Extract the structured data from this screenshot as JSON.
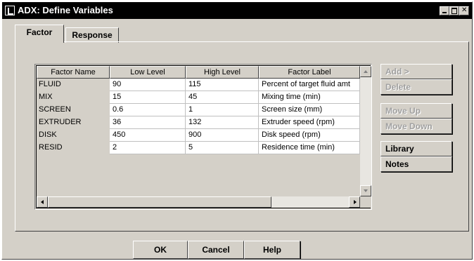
{
  "window": {
    "title": "ADX: Define Variables",
    "icon": "app-icon",
    "controls": [
      "minimize-icon",
      "maximize-icon",
      "close-icon"
    ]
  },
  "tabs": [
    {
      "label": "Factor",
      "active": true
    },
    {
      "label": "Response",
      "active": false
    }
  ],
  "table": {
    "columns": [
      "Factor Name",
      "Low Level",
      "High Level",
      "Factor Label"
    ],
    "rows": [
      [
        "FLUID",
        "90",
        "115",
        "Percent of target fluid amt"
      ],
      [
        "MIX",
        "15",
        "45",
        "Mixing time (min)"
      ],
      [
        "SCREEN",
        "0.6",
        "1",
        "Screen size (mm)"
      ],
      [
        "EXTRUDER",
        "36",
        "132",
        "Extruder speed (rpm)"
      ],
      [
        "DISK",
        "450",
        "900",
        "Disk speed (rpm)"
      ],
      [
        "RESID",
        "2",
        "5",
        "Residence time (min)"
      ]
    ]
  },
  "side_buttons": [
    {
      "label": "Add >",
      "enabled": false
    },
    {
      "label": "Delete",
      "enabled": false
    },
    {
      "label": "Move Up",
      "enabled": false
    },
    {
      "label": "Move Down",
      "enabled": false
    },
    {
      "label": "Library",
      "enabled": true
    },
    {
      "label": "Notes",
      "enabled": true
    }
  ],
  "footer_buttons": {
    "ok": "OK",
    "cancel": "Cancel",
    "help": "Help"
  }
}
